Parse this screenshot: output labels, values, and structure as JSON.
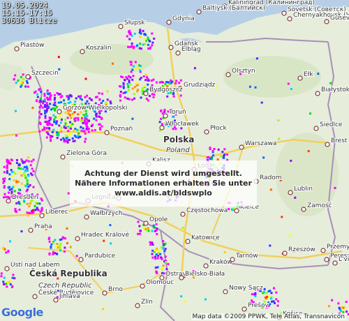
{
  "timestamp": {
    "date": "19.05.2024",
    "time_range": "15:15-17:15",
    "count": "30636 Blitze"
  },
  "notice": {
    "line1": "Achtung der Dienst wird umgestellt.",
    "line2": "Nähere Informationen erhalten Sie unter",
    "line3": "www.aldis.at/bldswplo"
  },
  "attribution": "Map data ©2009 PPWK, Tele Atlas, Transnavicon",
  "google_logo": "Google",
  "countries": [
    {
      "name": "Polska"
    },
    {
      "name": "Poland"
    },
    {
      "name": "Česká Republika"
    },
    {
      "name": "Czech Republic"
    }
  ],
  "cities": [
    "Kaliningrad (Калининград)",
    "Baltiysk (Балтийск)",
    "Sovetsk (Советск)",
    "Chernyakhovsk (Черняховск)",
    "Gusev (Гусев)",
    "Słupsk",
    "Gdynia",
    "Gdańsk",
    "Elbląg",
    "Pìastów",
    "Koszalin",
    "Olsztyn",
    "Ełk",
    "Szczecin",
    "Grudziądz",
    "Białystok",
    "Bydgoszcz",
    "Toruń",
    "Włocławek",
    "Gorzów Wielkopolski",
    "Poznań",
    "Płock",
    "Warszawa",
    "Siedlce",
    "Brest (Брест)",
    "Zielona Góra",
    "Kalisz",
    "Łódź",
    "Radom",
    "Lublin",
    "Legnica",
    "Wrocław",
    "Kielce",
    "Częstochowa",
    "Dresden",
    "Liberec",
    "Wałbrzych",
    "Opole",
    "Zamość",
    "Praha",
    "Hradec Králové",
    "Pardubice",
    "Katowice",
    "Rzeszów",
    "Przemyśl (Перемышль)",
    "Peresyp (Пересыпь)",
    "L'viv (Львів)",
    "Kraków",
    "Tarnów",
    "Ostrava",
    "Bielsko-Biała",
    "Olomouc",
    "Brno",
    "Zlín",
    "Nowy Sącz",
    "Prešov",
    "České Budějovice",
    "Jihlava",
    "Košice",
    "Ústí nad Labem"
  ],
  "colors": {
    "land": "#e6eddb",
    "sea": "#b6cfe6",
    "border": "#a88fb8",
    "road": "#f6dc74"
  }
}
